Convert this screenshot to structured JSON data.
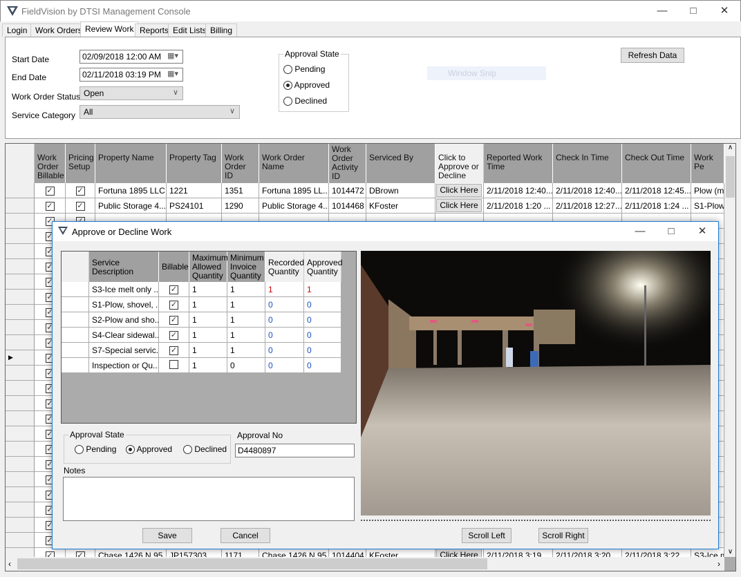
{
  "app": {
    "title": "FieldVision by DTSI Management Console",
    "icon": "fieldvision-logo-icon",
    "controls": [
      "minimize",
      "maximize",
      "close"
    ]
  },
  "tabs": [
    {
      "label": "Login"
    },
    {
      "label": "Work Orders"
    },
    {
      "label": "Review Work",
      "active": true
    },
    {
      "label": "Reports"
    },
    {
      "label": "Edit Lists"
    },
    {
      "label": "Billing"
    }
  ],
  "filters": {
    "start_date_label": "Start Date",
    "start_date": "02/09/2018 12:00 AM",
    "end_date_label": "End Date",
    "end_date": "02/11/2018 03:19 PM",
    "status_label": "Work Order Status",
    "status": "Open",
    "category_label": "Service Category",
    "category": "All",
    "approval_label": "Approval State",
    "approval_options": [
      "Pending",
      "Approved",
      "Declined"
    ],
    "approval_selected": "Approved",
    "refresh_label": "Refresh Data",
    "ghost_text": "Window Snip"
  },
  "grid": {
    "columns": [
      "Work Order Billable",
      "Pricing Setup",
      "Property Name",
      "Property Tag",
      "Work Order ID",
      "Work Order Name",
      "Work Order Activity ID",
      "Serviced By",
      "Click to Approve or Decline",
      "Reported Work Time",
      "Check In Time",
      "Check Out Time",
      "Work Pe"
    ],
    "button_label": "Click Here",
    "rows": [
      {
        "billable": true,
        "pricing": true,
        "property": "Fortuna 1895 LLC",
        "tag": "1221",
        "wo_id": "1351",
        "wo_name": "Fortuna 1895 LL...",
        "activity": "1014472",
        "by": "DBrown",
        "reported": "2/11/2018 12:40...",
        "checkin": "2/11/2018 12:40...",
        "checkout": "2/11/2018 12:45...",
        "work": "Plow (mar"
      },
      {
        "billable": true,
        "pricing": true,
        "property": "Public Storage 4...",
        "tag": "PS24101",
        "wo_id": "1290",
        "wo_name": "Public Storage 4...",
        "activity": "1014468",
        "by": "KFoster",
        "reported": "2/11/2018 1:20 ...",
        "checkin": "2/11/2018 12:27...",
        "checkout": "2/11/2018 1:24 ...",
        "work": "S1-Plow, "
      },
      {
        "billable": true,
        "pricing": true,
        "property": "Chase 1426 N 95...",
        "tag": "JP157303",
        "wo_id": "1171",
        "wo_name": "Chase 1426 N 95...",
        "activity": "1014404",
        "by": "KFoster",
        "reported": "2/11/2018 3:19 ...",
        "checkin": "2/11/2018 3:20 ...",
        "checkout": "2/11/2018 3:22 ...",
        "work": "S3-Ice me"
      }
    ]
  },
  "dialog": {
    "title": "Approve or Decline Work",
    "columns": [
      "Service Description",
      "Billable",
      "Maximum Allowed Quantity",
      "Minimum Invoice Quantity",
      "Recorded Quantity",
      "Approved Quantity"
    ],
    "rows": [
      {
        "desc": "S3-Ice melt only ...",
        "billable": true,
        "max": "1",
        "min": "1",
        "recorded": "1",
        "approved": "1"
      },
      {
        "desc": "S1-Plow, shovel, ...",
        "billable": true,
        "max": "1",
        "min": "1",
        "recorded": "0",
        "approved": "0"
      },
      {
        "desc": "S2-Plow and sho...",
        "billable": true,
        "max": "1",
        "min": "1",
        "recorded": "0",
        "approved": "0"
      },
      {
        "desc": "S4-Clear sidewal...",
        "billable": true,
        "max": "1",
        "min": "1",
        "recorded": "0",
        "approved": "0"
      },
      {
        "desc": "S7-Special servic...",
        "billable": true,
        "max": "1",
        "min": "1",
        "recorded": "0",
        "approved": "0"
      },
      {
        "desc": "Inspection or Qu...",
        "billable": false,
        "max": "1",
        "min": "0",
        "recorded": "0",
        "approved": "0"
      }
    ],
    "approval_label": "Approval State",
    "approval_options": [
      "Pending",
      "Approved",
      "Declined"
    ],
    "approval_selected": "Approved",
    "approval_no_label": "Approval No",
    "approval_no": "D4480897",
    "notes_label": "Notes",
    "notes": "",
    "save_label": "Save",
    "cancel_label": "Cancel",
    "scroll_left_label": "Scroll Left",
    "scroll_right_label": "Scroll Right"
  }
}
